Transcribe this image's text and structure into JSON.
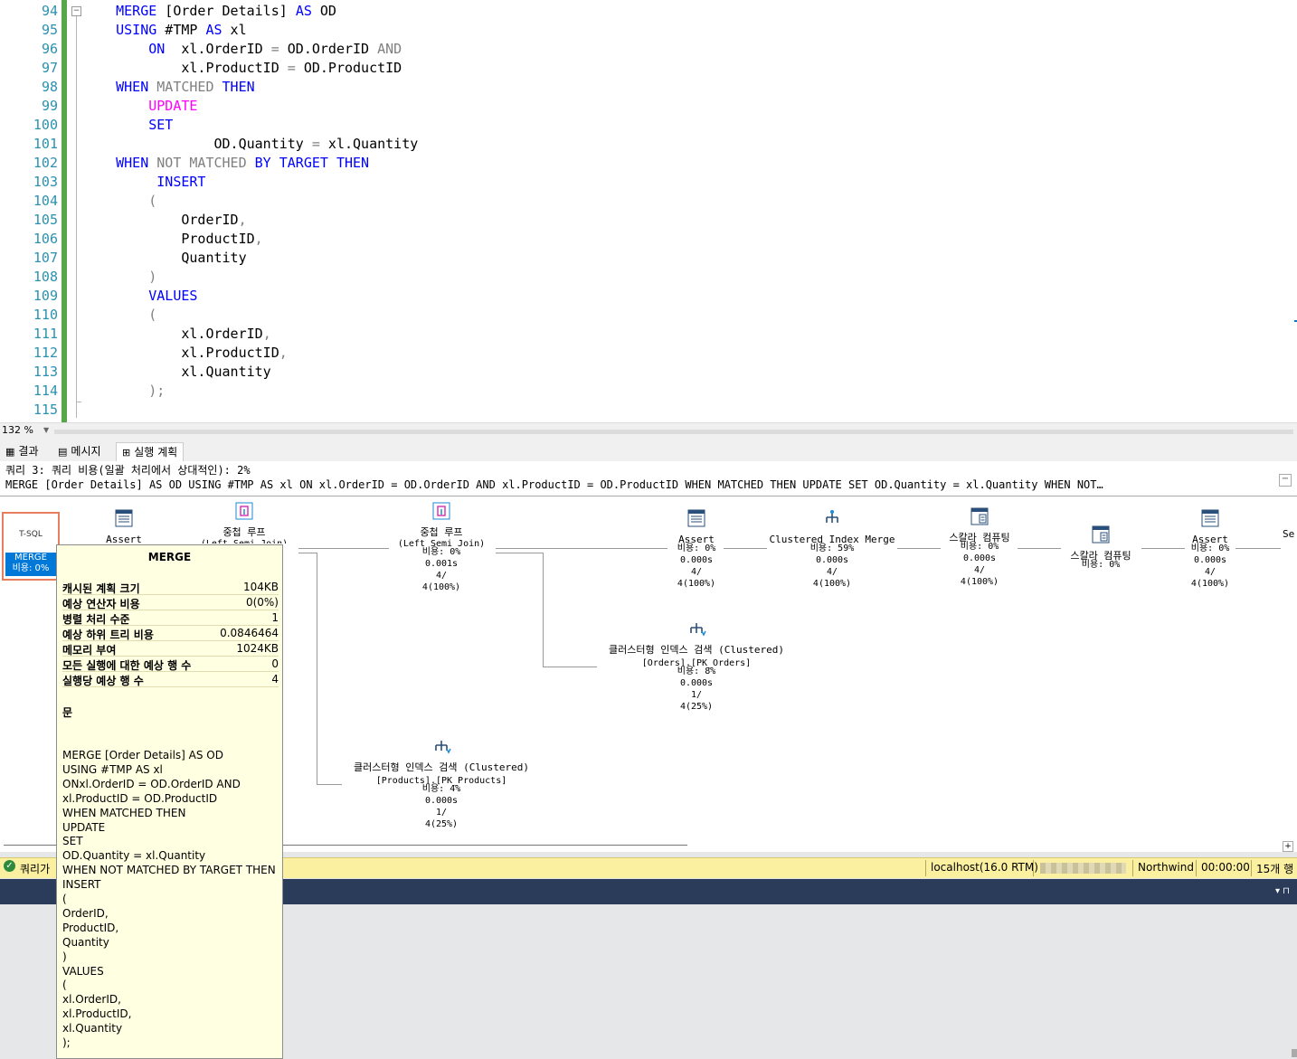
{
  "editor": {
    "line_numbers": [
      "94",
      "95",
      "96",
      "97",
      "98",
      "99",
      "100",
      "101",
      "102",
      "103",
      "104",
      "105",
      "106",
      "107",
      "108",
      "109",
      "110",
      "111",
      "112",
      "113",
      "114",
      "115"
    ],
    "lines": [
      [
        {
          "t": "    ",
          "c": ""
        },
        {
          "t": "MERGE",
          "c": "kw"
        },
        {
          "t": " [Order Details] ",
          "c": ""
        },
        {
          "t": "AS",
          "c": "kw"
        },
        {
          "t": " OD",
          "c": ""
        }
      ],
      [
        {
          "t": "    ",
          "c": ""
        },
        {
          "t": "USING",
          "c": "kw"
        },
        {
          "t": " #TMP ",
          "c": ""
        },
        {
          "t": "AS",
          "c": "kw"
        },
        {
          "t": " xl",
          "c": ""
        }
      ],
      [
        {
          "t": "        ",
          "c": ""
        },
        {
          "t": "ON",
          "c": "kw"
        },
        {
          "t": "  xl.OrderID ",
          "c": ""
        },
        {
          "t": "=",
          "c": "gr"
        },
        {
          "t": " OD.OrderID ",
          "c": ""
        },
        {
          "t": "AND",
          "c": "gr"
        }
      ],
      [
        {
          "t": "            xl.ProductID ",
          "c": ""
        },
        {
          "t": "=",
          "c": "gr"
        },
        {
          "t": " OD.ProductID",
          "c": ""
        }
      ],
      [
        {
          "t": "    ",
          "c": ""
        },
        {
          "t": "WHEN",
          "c": "kw"
        },
        {
          "t": " MATCHED ",
          "c": "gr"
        },
        {
          "t": "THEN",
          "c": "kw"
        }
      ],
      [
        {
          "t": "        ",
          "c": ""
        },
        {
          "t": "UPDATE",
          "c": "pk"
        }
      ],
      [
        {
          "t": "        ",
          "c": ""
        },
        {
          "t": "SET",
          "c": "kw"
        }
      ],
      [
        {
          "t": "                OD.Quantity ",
          "c": ""
        },
        {
          "t": "=",
          "c": "gr"
        },
        {
          "t": " xl.Quantity",
          "c": ""
        }
      ],
      [
        {
          "t": "    ",
          "c": ""
        },
        {
          "t": "WHEN",
          "c": "kw"
        },
        {
          "t": " NOT MATCHED ",
          "c": "gr"
        },
        {
          "t": "BY TARGET THEN",
          "c": "kw"
        }
      ],
      [
        {
          "t": "         ",
          "c": ""
        },
        {
          "t": "INSERT",
          "c": "kw"
        }
      ],
      [
        {
          "t": "        (",
          "c": "gr"
        }
      ],
      [
        {
          "t": "            OrderID",
          "c": ""
        },
        {
          "t": ",",
          "c": "gr"
        }
      ],
      [
        {
          "t": "            ProductID",
          "c": ""
        },
        {
          "t": ",",
          "c": "gr"
        }
      ],
      [
        {
          "t": "            Quantity",
          "c": ""
        }
      ],
      [
        {
          "t": "        )",
          "c": "gr"
        }
      ],
      [
        {
          "t": "        ",
          "c": ""
        },
        {
          "t": "VALUES",
          "c": "kw"
        }
      ],
      [
        {
          "t": "        (",
          "c": "gr"
        }
      ],
      [
        {
          "t": "            xl.OrderID",
          "c": ""
        },
        {
          "t": ",",
          "c": "gr"
        }
      ],
      [
        {
          "t": "            xl.ProductID",
          "c": ""
        },
        {
          "t": ",",
          "c": "gr"
        }
      ],
      [
        {
          "t": "            xl.Quantity",
          "c": ""
        }
      ],
      [
        {
          "t": "        );",
          "c": "gr"
        }
      ],
      [
        {
          "t": "",
          "c": ""
        }
      ]
    ]
  },
  "zoom": {
    "value": "132 %"
  },
  "tabs": {
    "results": "결과",
    "messages": "메시지",
    "plan": "실행 계획"
  },
  "plan": {
    "header1": "쿼리 3: 쿼리 비용(일괄 처리에서 상대적인): 2%",
    "header2": "MERGE [Order Details] AS OD USING #TMP AS xl ON xl.OrderID = OD.OrderID AND xl.ProductID = OD.ProductID WHEN MATCHED THEN UPDATE SET OD.Quantity = xl.Quantity WHEN NOT…",
    "tsql_label": "T-SQL",
    "root_name": "MERGE",
    "root_cost": "비용: 0%",
    "nodes": {
      "assert1": {
        "title": "Assert",
        "lines": []
      },
      "nested1": {
        "title": "중첩 루프",
        "lines": [
          "(Left Semi Join)"
        ]
      },
      "nested2": {
        "title": "중첩 루프",
        "lines": [
          "(Left Semi Join)",
          "비용: 0%",
          "0.001s",
          "4/",
          "4(100%)"
        ]
      },
      "assert2": {
        "title": "Assert",
        "lines": [
          "비용: 0%",
          "0.000s",
          "4/",
          "4(100%)"
        ]
      },
      "cim": {
        "title": "Clustered Index Merge",
        "lines": [
          "비용: 59%",
          "0.000s",
          "4/",
          "4(100%)"
        ]
      },
      "scalar1": {
        "title": "스칼라 컴퓨팅",
        "lines": [
          "비용: 0%",
          "0.000s",
          "4/",
          "4(100%)"
        ]
      },
      "scalar2": {
        "title": "스칼라 컴퓨팅",
        "lines": [
          "비용: 0%"
        ]
      },
      "assert3": {
        "title": "Assert",
        "lines": [
          "비용: 0%",
          "0.000s",
          "4/",
          "4(100%)"
        ]
      },
      "seek_orders": {
        "title": "클러스터형 인덱스 검색 (Clustered)",
        "lines": [
          "[Orders].[PK_Orders]",
          "비용: 8%",
          "0.000s",
          "1/",
          "4(25%)"
        ]
      },
      "seek_products": {
        "title": "클러스터형 인덱스 검색 (Clustered)",
        "lines": [
          "[Products].[PK_Products]",
          "비용: 4%",
          "0.000s",
          "1/",
          "4(25%)"
        ]
      },
      "edge_cut": {
        "title": "Se"
      }
    }
  },
  "tooltip": {
    "title": "MERGE",
    "rows": [
      {
        "k": "캐시된 계획 크기",
        "v": "104KB"
      },
      {
        "k": "예상 연산자 비용",
        "v": "0(0%)"
      },
      {
        "k": "병렬 처리 수준",
        "v": "1"
      },
      {
        "k": "예상 하위 트리 비용",
        "v": "0.0846464"
      },
      {
        "k": "메모리 부여",
        "v": "1024KB"
      },
      {
        "k": "모든 실행에 대한 예상 행 수",
        "v": "0"
      },
      {
        "k": "실행당 예상 행 수",
        "v": "4"
      }
    ],
    "statement_label": "문",
    "statement": [
      "MERGE [Order Details] AS OD",
      "USING #TMP AS xl",
      "ONxl.OrderID = OD.OrderID AND",
      "xl.ProductID = OD.ProductID",
      "WHEN MATCHED THEN",
      "UPDATE",
      "SET",
      "OD.Quantity = xl.Quantity",
      "WHEN NOT MATCHED BY TARGET THEN",
      "INSERT",
      "(",
      "OrderID,",
      "ProductID,",
      "Quantity",
      ")",
      "VALUES",
      "(",
      "xl.OrderID,",
      "xl.ProductID,",
      "xl.Quantity",
      ");"
    ]
  },
  "status": {
    "message": "쿼리가",
    "server": "localhost(16.0 RTM)",
    "database": "Northwind",
    "time": "00:00:00",
    "rows": "15개 행"
  },
  "colors": {
    "keyword": "#0000ff",
    "pink": "#ff00ff",
    "gray": "#808080",
    "status_bg": "#fbf0a0",
    "dark_bar": "#2b3c5a",
    "selection": "#0078d7"
  }
}
